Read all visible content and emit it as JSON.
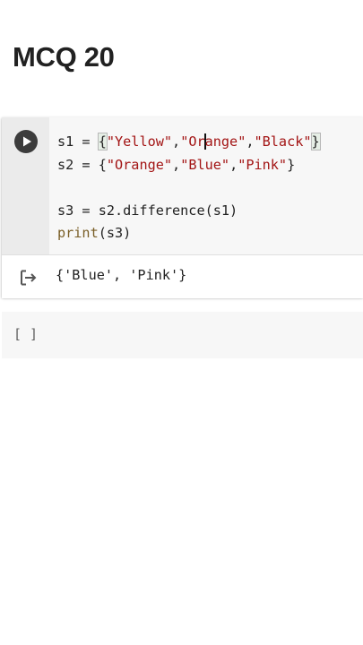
{
  "heading": "MCQ 20",
  "code_cell": {
    "run_icon": "play-circle-icon",
    "lines": {
      "l1": {
        "var": "s1 = ",
        "open": "{",
        "s1": "\"Yellow\"",
        "c1": ",",
        "s2a": "\"Or",
        "s2b": "ange\"",
        "c2": ",",
        "s3": "\"Black\"",
        "close": "}"
      },
      "l2": {
        "var": "s2 = {",
        "s1": "\"Orange\"",
        "c1": ",",
        "s2": "\"Blue\"",
        "c2": ",",
        "s3": "\"Pink\"",
        "close": "}"
      },
      "l4": "s3 = s2.difference(s1)",
      "l5": {
        "kw": "print",
        "rest": "(s3)"
      }
    },
    "output_icon": "output-redirect-icon",
    "output": "{'Blue', 'Pink'}"
  },
  "empty_cell": {
    "run_label": "[ ]"
  }
}
